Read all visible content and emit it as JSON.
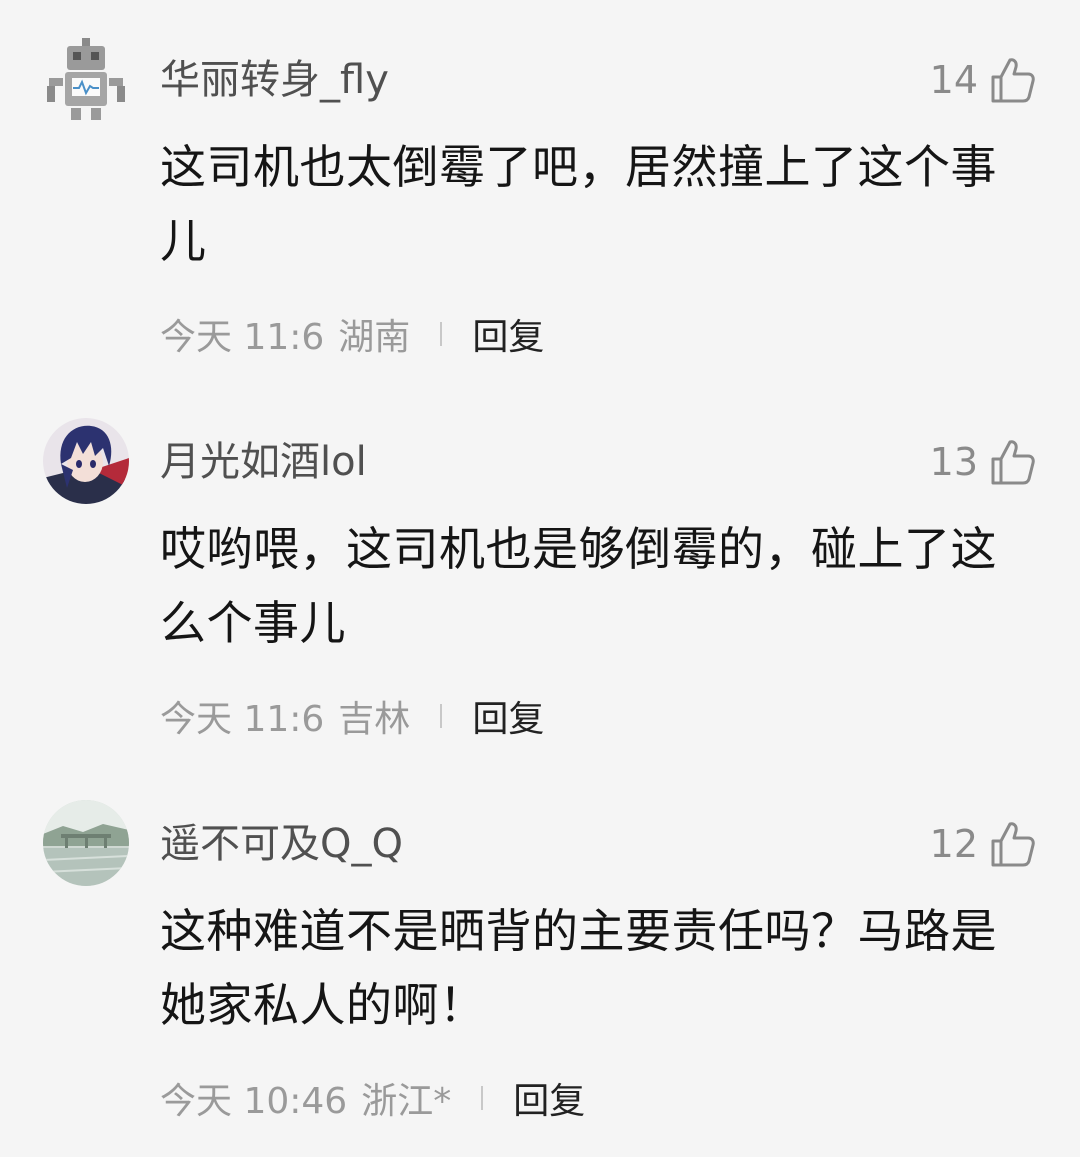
{
  "comments": [
    {
      "avatar": "robot-avatar",
      "username": "华丽转身_fly",
      "likes": "14",
      "text": "这司机也太倒霉了吧，居然撞上了这个事儿",
      "time": "今天 11:6",
      "location": "湖南",
      "reply_label": "回复"
    },
    {
      "avatar": "anime-character-avatar",
      "username": "月光如酒lol",
      "likes": "13",
      "text": "哎哟喂，这司机也是够倒霉的，碰上了这么个事儿",
      "time": "今天 11:6",
      "location": "吉林",
      "reply_label": "回复"
    },
    {
      "avatar": "landscape-bridge-avatar",
      "username": "遥不可及Q_Q",
      "likes": "12",
      "text": "这种难道不是晒背的主要责任吗？马路是她家私人的啊！",
      "time": "今天 10:46",
      "location": "浙江*",
      "reply_label": "回复"
    }
  ],
  "icons": {
    "like": "thumbs-up-icon"
  },
  "colors": {
    "background": "#f5f5f5",
    "username": "#505050",
    "body_text": "#151515",
    "meta_text": "#9a9a9a"
  }
}
